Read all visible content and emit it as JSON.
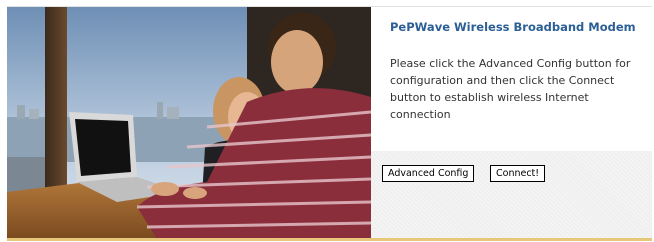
{
  "panel": {
    "title": "PePWave Wireless Broadband Modem",
    "description": "Please click the Advanced Config button for configuration and then click the Connect button to establish wireless Internet connection"
  },
  "buttons": {
    "advanced_config": "Advanced Config",
    "connect": "Connect!"
  },
  "colors": {
    "title": "#2b5f95",
    "button_area": "#efefef",
    "bottom_accent": "#e7c87a"
  }
}
